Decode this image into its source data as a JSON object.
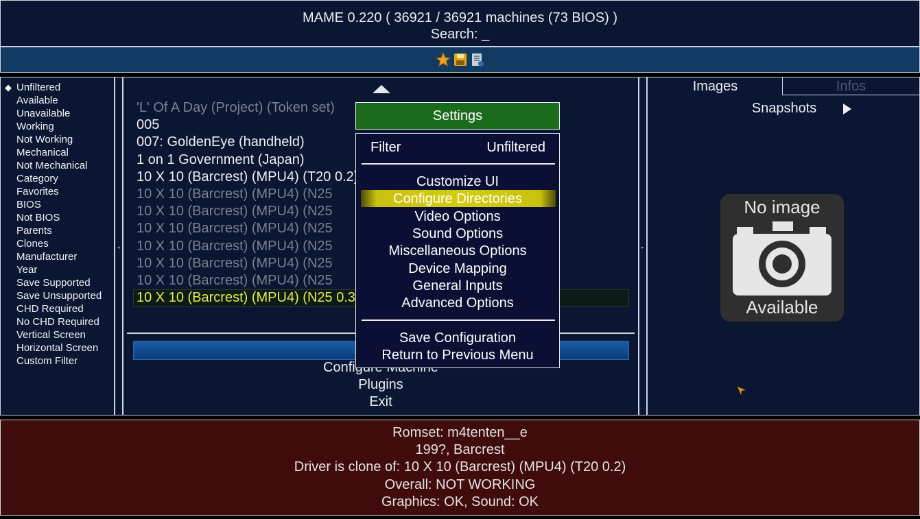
{
  "header": {
    "title": "MAME 0.220 ( 36921 / 36921 machines (73 BIOS) )",
    "search": "Search: _"
  },
  "toolbar": {
    "icons": [
      "star-icon",
      "floppy-disk-icon",
      "document-icon"
    ]
  },
  "filters": {
    "selected_marker": "◆",
    "items": [
      "Unfiltered",
      "Available",
      "Unavailable",
      "Working",
      "Not Working",
      "Mechanical",
      "Not Mechanical",
      "Category",
      "Favorites",
      "BIOS",
      "Not BIOS",
      "Parents",
      "Clones",
      "Manufacturer",
      "Year",
      "Save Supported",
      "Save Unsupported",
      "CHD Required",
      "No CHD Required",
      "Vertical Screen",
      "Horizontal Screen",
      "Custom Filter"
    ]
  },
  "game_list": {
    "items": [
      {
        "label": "'L' Of A Day (Project) (Token set)",
        "style": "dim"
      },
      {
        "label": "005",
        "style": "norm"
      },
      {
        "label": "007: GoldenEye (handheld)",
        "style": "norm"
      },
      {
        "label": "1 on 1 Government (Japan)",
        "style": "norm"
      },
      {
        "label": "10 X 10 (Barcrest) (MPU4) (T20 0.2)",
        "style": "norm"
      },
      {
        "label": "10 X 10 (Barcrest) (MPU4) (N25",
        "style": "dim"
      },
      {
        "label": "10 X 10 (Barcrest) (MPU4) (N25",
        "style": "dim"
      },
      {
        "label": "10 X 10 (Barcrest) (MPU4) (N25",
        "style": "dim"
      },
      {
        "label": "10 X 10 (Barcrest) (MPU4) (N25",
        "style": "dim"
      },
      {
        "label": "10 X 10 (Barcrest) (MPU4) (N25",
        "style": "dim"
      },
      {
        "label": "10 X 10 (Barcrest) (MPU4) (N25",
        "style": "dim"
      },
      {
        "label": "10 X 10 (Barcrest) (MPU4) (N25 0.3 KP)",
        "style": "sel"
      }
    ]
  },
  "main_menu": {
    "selected": "Confi",
    "items": [
      "Configure Machine",
      "Plugins",
      "Exit"
    ]
  },
  "settings": {
    "title": "Settings",
    "filter_label": "Filter",
    "filter_value": "Unfiltered",
    "items": [
      "Customize UI",
      "Configure Directories",
      "Video Options",
      "Sound Options",
      "Miscellaneous Options",
      "Device Mapping",
      "General Inputs",
      "Advanced Options"
    ],
    "highlighted": "Configure Directories",
    "footer": [
      "Save Configuration",
      "Return to Previous Menu"
    ]
  },
  "right_panel": {
    "tabs": [
      "Images",
      "Infos"
    ],
    "active_tab": "Images",
    "view": "Snapshots",
    "placeholder_top": "No image",
    "placeholder_bottom": "Available"
  },
  "info": {
    "lines": [
      "Romset: m4tenten__e",
      "199?, Barcrest",
      "Driver is clone of: 10 X 10 (Barcrest) (MPU4) (T20 0.2)",
      "Overall: NOT WORKING",
      "Graphics: OK, Sound: OK"
    ]
  },
  "colors": {
    "panel_bg": "#0b1633",
    "info_bg": "#3f0b0b",
    "settings_title_bg": "#1c6b1c",
    "highlight": "#d4cc10",
    "selected_text": "#e6ec4a"
  }
}
